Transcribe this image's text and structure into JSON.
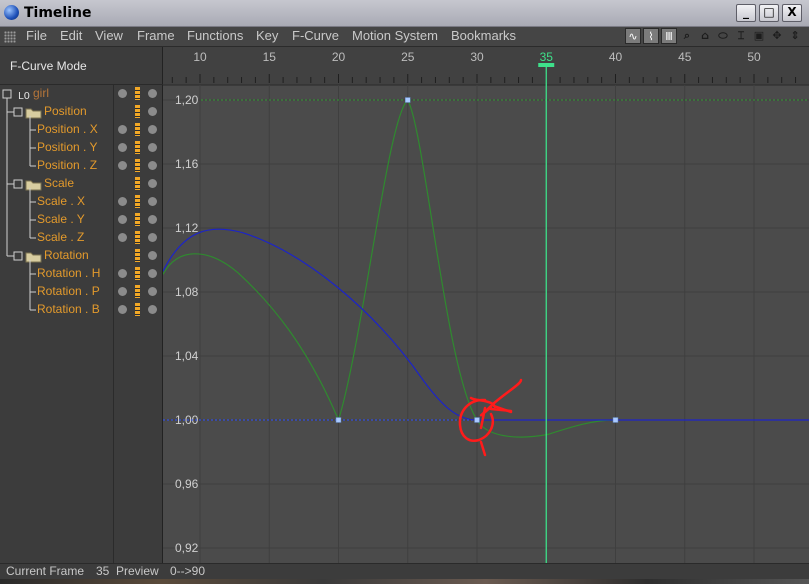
{
  "window": {
    "title": "Timeline",
    "controls": [
      "_",
      "□",
      "X"
    ]
  },
  "menu": [
    "File",
    "Edit",
    "View",
    "Frame",
    "Functions",
    "Key",
    "F-Curve",
    "Motion System",
    "Bookmarks"
  ],
  "toolbar": {
    "icons": [
      "curve-tool-icon",
      "waveform-icon",
      "keys-icon",
      "magnify-icon",
      "home-icon",
      "ellipse-icon",
      "bracket-icon",
      "frame-icon",
      "move-icon",
      "updown-icon"
    ]
  },
  "left_panel": {
    "mode_label": "F-Curve Mode",
    "tree": [
      {
        "label": "girl",
        "kind": "object"
      },
      {
        "label": "Position",
        "kind": "folder"
      },
      {
        "label": "Position . X",
        "kind": "track"
      },
      {
        "label": "Position . Y",
        "kind": "track"
      },
      {
        "label": "Position . Z",
        "kind": "track"
      },
      {
        "label": "Scale",
        "kind": "folder"
      },
      {
        "label": "Scale . X",
        "kind": "track"
      },
      {
        "label": "Scale . Y",
        "kind": "track"
      },
      {
        "label": "Scale . Z",
        "kind": "track"
      },
      {
        "label": "Rotation",
        "kind": "folder"
      },
      {
        "label": "Rotation . H",
        "kind": "track"
      },
      {
        "label": "Rotation . P",
        "kind": "track"
      },
      {
        "label": "Rotation . B",
        "kind": "track"
      }
    ]
  },
  "graph": {
    "frame_ticks": [
      10,
      15,
      20,
      25,
      30,
      35,
      40,
      45,
      50
    ],
    "value_ticks": [
      "1,20",
      "1,16",
      "1,12",
      "1,08",
      "1,04",
      "1,00",
      "0,96",
      "0,92"
    ],
    "current_frame": 35,
    "colors": {
      "background": "#4b4b4b",
      "grid": "#3f3f3f",
      "green_curve": "#2f8a2f",
      "blue_curve": "#1c24c8",
      "playhead": "#3ee08a",
      "annotation": "#ff1b1b",
      "keyframe": "#a9c9ff"
    }
  },
  "status": {
    "current_frame_label": "Current Frame",
    "current_frame_value": "35",
    "preview_label": "Preview",
    "preview_range": "0-->90"
  }
}
